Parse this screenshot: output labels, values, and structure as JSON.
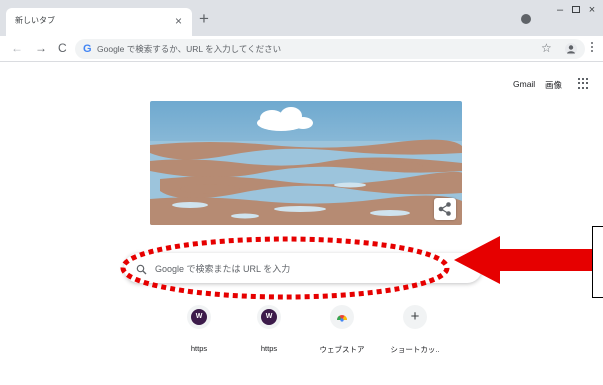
{
  "tab": {
    "title": "新しいタブ",
    "close": "×",
    "new_tab": "+"
  },
  "window": {
    "minimize": "–",
    "close": "×"
  },
  "toolbar": {
    "back": "←",
    "forward": "→",
    "reload": "C",
    "omnibox_icon": "G",
    "omnibox_text": "Google で検索するか、URL を入力してください",
    "bookmark": "☆"
  },
  "top_links": {
    "gmail": "Gmail",
    "images": "画像"
  },
  "search": {
    "placeholder": "Google で検索または URL を入力"
  },
  "shortcuts": [
    {
      "label": "https",
      "icon": "w-favicon",
      "glyph": "W"
    },
    {
      "label": "https",
      "icon": "w-favicon",
      "glyph": "W"
    },
    {
      "label": "ウェブストア",
      "icon": "webstore-icon",
      "glyph": ""
    },
    {
      "label": "ショートカッ..",
      "icon": "plus-icon",
      "glyph": "+"
    }
  ],
  "colors": {
    "annotation": "#e60000",
    "tabstrip": "#dee1e6",
    "omnibox": "#f1f3f4",
    "sky": "#8db9d6",
    "mud": "#b68b73"
  }
}
